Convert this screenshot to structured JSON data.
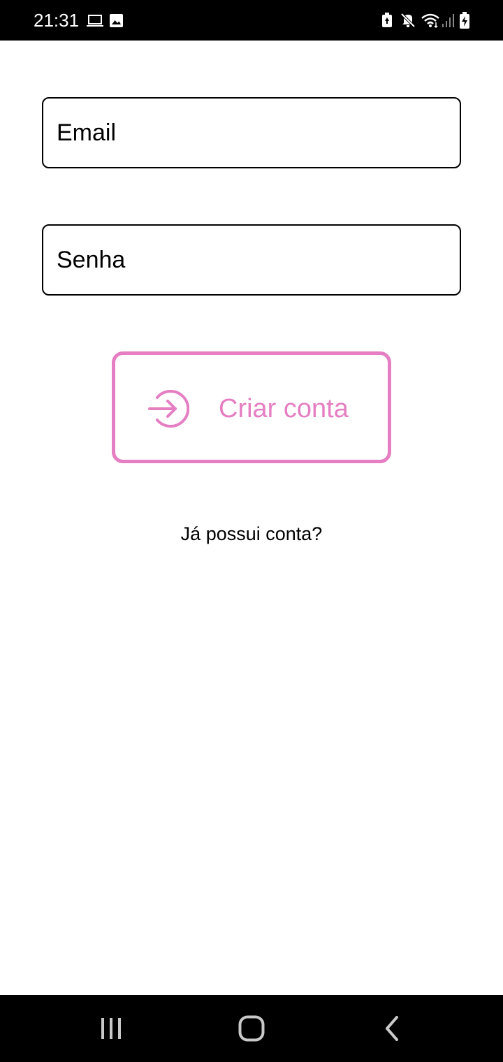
{
  "status_bar": {
    "time": "21:31",
    "left_icons": [
      "laptop-icon",
      "image-icon"
    ],
    "right_icons": [
      "battery-saver-icon",
      "mute-icon",
      "wifi-icon",
      "signal-icon",
      "battery-charging-icon"
    ]
  },
  "form": {
    "email_placeholder": "Email",
    "password_placeholder": "Senha"
  },
  "create_button": {
    "label": "Criar conta",
    "icon": "login-arrow-icon"
  },
  "login_link": {
    "label": "Já possui conta?"
  },
  "nav_bar": {
    "buttons": [
      "recent-apps-icon",
      "home-icon",
      "back-icon"
    ]
  },
  "colors": {
    "accent": "#e57ec2",
    "text": "#000000",
    "background": "#ffffff",
    "system_bars": "#000000"
  }
}
